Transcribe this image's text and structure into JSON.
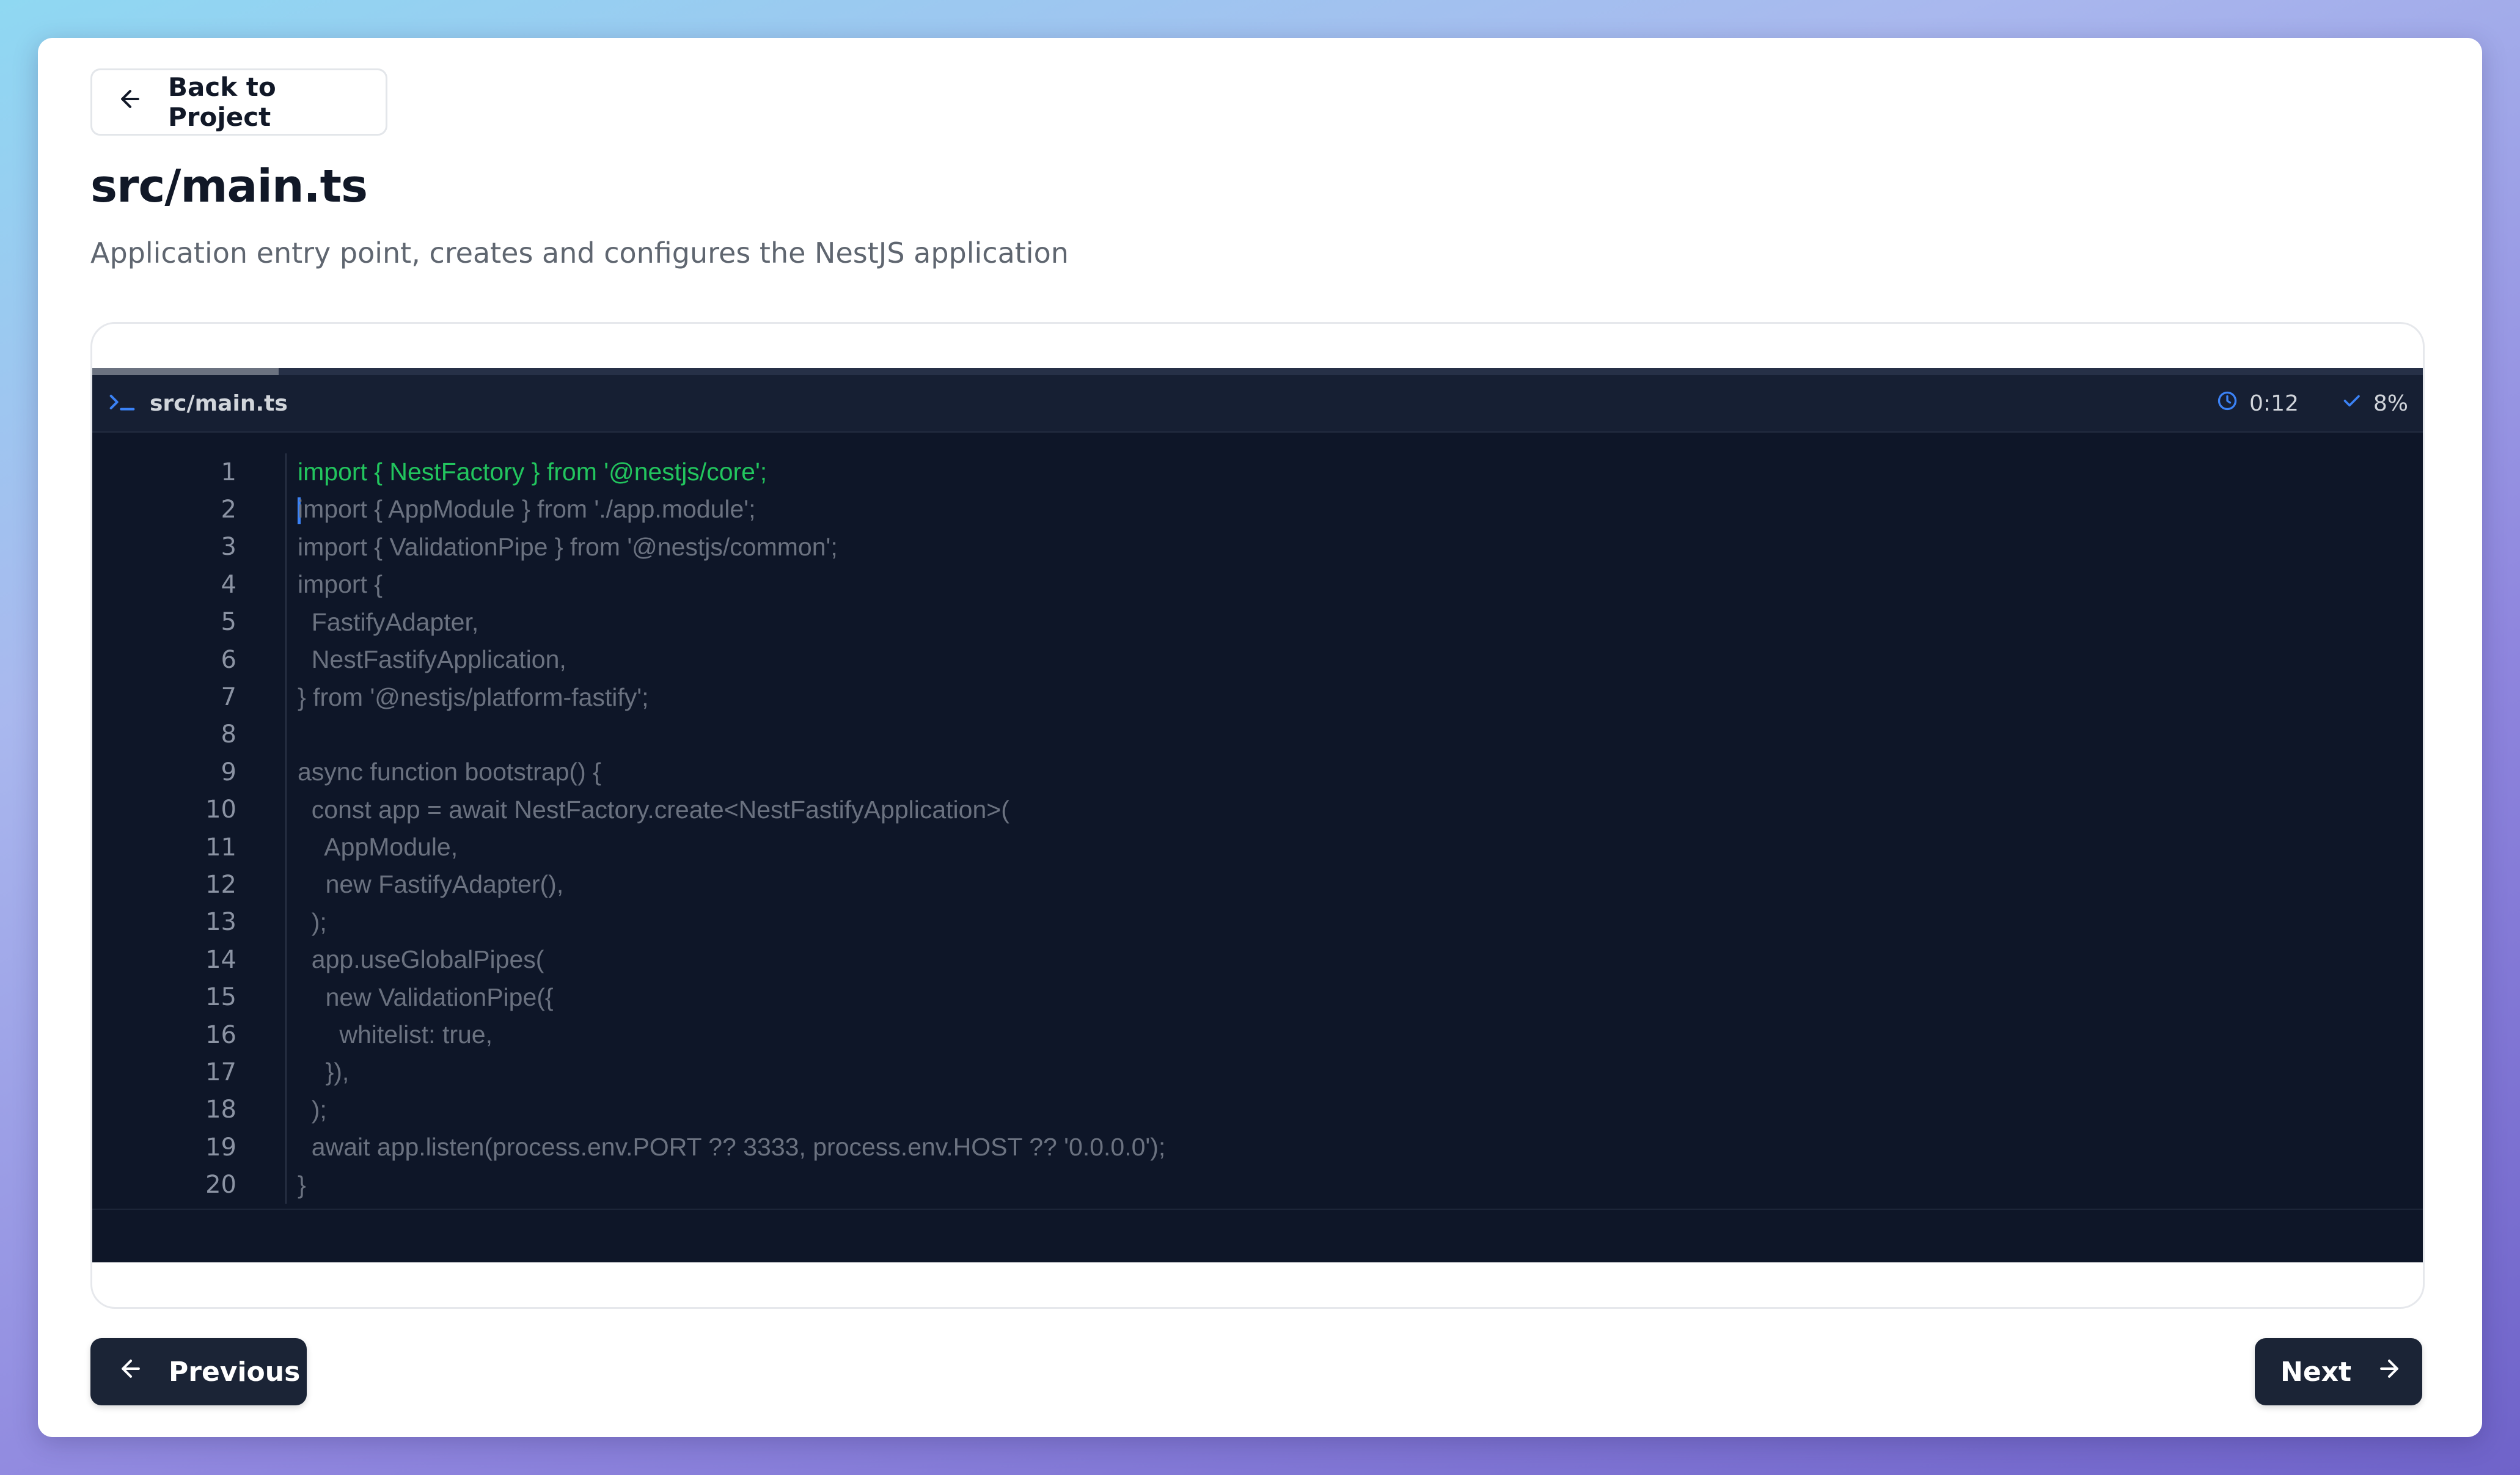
{
  "header": {
    "back_label": "Back to Project",
    "title": "src/main.ts",
    "subtitle": "Application entry point, creates and configures the NestJS application"
  },
  "editor": {
    "filename": "src/main.ts",
    "timer": "0:12",
    "progress_label": "8%",
    "progress": 0.08,
    "active_line": 1,
    "cursor_line": 2,
    "lines": [
      {
        "n": "1",
        "text": "import { NestFactory } from '@nestjs/core';"
      },
      {
        "n": "2",
        "text": "import { AppModule } from './app.module';"
      },
      {
        "n": "3",
        "text": "import { ValidationPipe } from '@nestjs/common';"
      },
      {
        "n": "4",
        "text": "import {"
      },
      {
        "n": "5",
        "text": "  FastifyAdapter,"
      },
      {
        "n": "6",
        "text": "  NestFastifyApplication,"
      },
      {
        "n": "7",
        "text": "} from '@nestjs/platform-fastify';"
      },
      {
        "n": "8",
        "text": ""
      },
      {
        "n": "9",
        "text": "async function bootstrap() {"
      },
      {
        "n": "10",
        "text": "  const app = await NestFactory.create<NestFastifyApplication>("
      },
      {
        "n": "11",
        "text": "    AppModule,"
      },
      {
        "n": "12",
        "text": "    new FastifyAdapter(),"
      },
      {
        "n": "13",
        "text": "  );"
      },
      {
        "n": "14",
        "text": "  app.useGlobalPipes("
      },
      {
        "n": "15",
        "text": "    new ValidationPipe({"
      },
      {
        "n": "16",
        "text": "      whitelist: true,"
      },
      {
        "n": "17",
        "text": "    }),"
      },
      {
        "n": "18",
        "text": "  );"
      },
      {
        "n": "19",
        "text": "  await app.listen(process.env.PORT ?? 3333, process.env.HOST ?? '0.0.0.0');"
      },
      {
        "n": "20",
        "text": "}"
      }
    ]
  },
  "footer": {
    "previous_label": "Previous",
    "next_label": "Next"
  },
  "icons": {
    "back": "arrow-left-icon",
    "terminal": "terminal-icon",
    "timer": "clock-icon",
    "progress": "check-icon",
    "previous": "arrow-left-icon",
    "next": "arrow-right-icon"
  },
  "colors": {
    "accent_blue": "#3b82f6",
    "active_code": "#22c55e",
    "inactive_code": "#6b7280",
    "terminal_bg": "#0e1628",
    "button_dark": "#1b2436"
  }
}
